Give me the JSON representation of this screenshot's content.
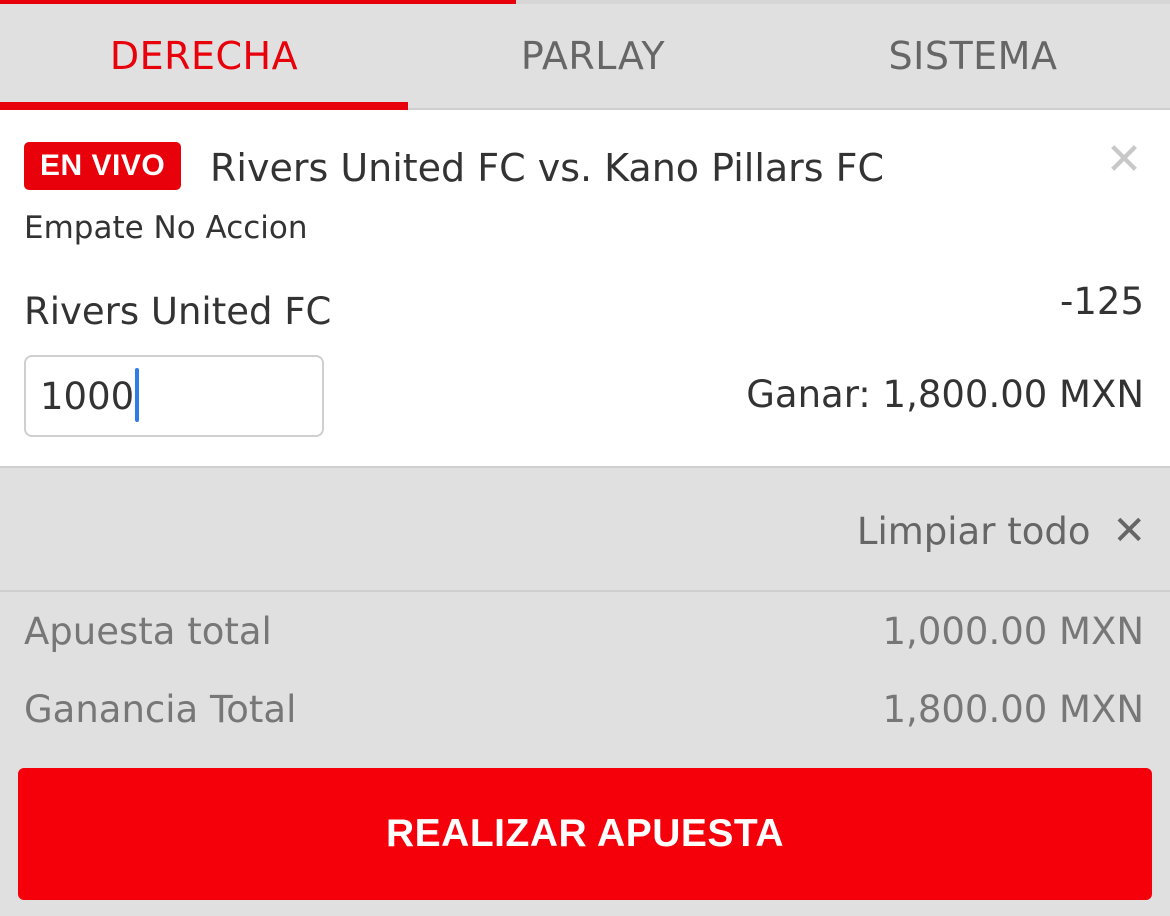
{
  "tabs": [
    {
      "label": "DERECHA",
      "active": true
    },
    {
      "label": "PARLAY",
      "active": false
    },
    {
      "label": "SISTEMA",
      "active": false
    }
  ],
  "bet": {
    "badge": "EN VIVO",
    "event": "Rivers United FC vs. Kano Pillars FC",
    "market": "Empate No Accion",
    "selection": "Rivers United FC",
    "odds": "-125",
    "stake_value": "1000",
    "win_text": "Ganar: 1,800.00 MXN"
  },
  "clear_all_label": "Limpiar todo",
  "totals": {
    "stake_label": "Apuesta total",
    "stake_value": "1,000.00 MXN",
    "profit_label": "Ganancia Total",
    "profit_value": "1,800.00 MXN"
  },
  "place_bet_label": "REALIZAR APUESTA",
  "colors": {
    "accent": "#e8000b",
    "button": "#f5000a",
    "background": "#e0e0e0"
  },
  "icons": {
    "remove_bet": "close-icon",
    "clear_all": "close-icon"
  }
}
